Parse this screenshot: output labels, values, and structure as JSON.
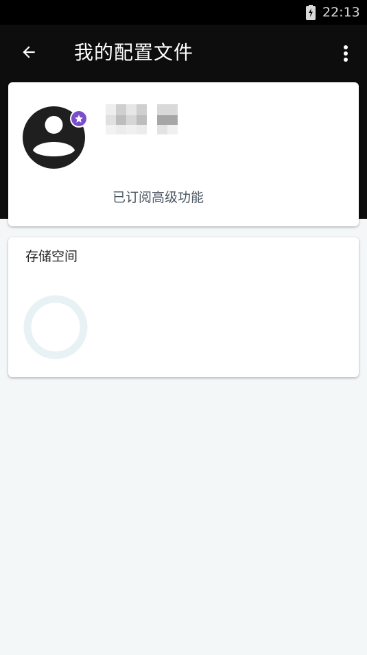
{
  "status_bar": {
    "time": "22:13",
    "battery_icon": "battery-charging-icon"
  },
  "app_bar": {
    "title": "我的配置文件",
    "back_icon": "arrow-left-icon",
    "more_icon": "more-vert-icon"
  },
  "profile": {
    "avatar_icon": "account-circle-icon",
    "badge_icon": "star-icon",
    "badge_color": "#7b4dc9",
    "subscription_text": "已订阅高级功能"
  },
  "storage": {
    "title": "存储空间"
  },
  "colors": {
    "header_bg": "#0d0d0d",
    "page_bg": "#f4f7f8",
    "ring_color": "#e8f1f3"
  }
}
